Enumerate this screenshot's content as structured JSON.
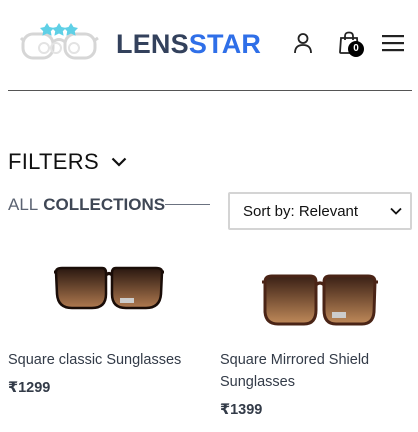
{
  "header": {
    "brand_part1": "LENS",
    "brand_part2": "STAR",
    "cart_count": "0",
    "brand_colors": {
      "dark": "#33415c",
      "accent": "#2f6fe8"
    },
    "icons": [
      "logo-glasses-icon",
      "user-icon",
      "shopping-bag-icon",
      "hamburger-menu-icon"
    ]
  },
  "filters": {
    "label": "FILTERS",
    "icon": "chevron-down-icon"
  },
  "collections": {
    "all_label": "ALL",
    "name_label": "COLLECTIONS"
  },
  "sort": {
    "selected": "Sort by: Relevant",
    "options": [
      "Sort by: Relevant"
    ]
  },
  "products": [
    {
      "name": "Square classic Sunglasses",
      "price": "₹1299"
    },
    {
      "name": "Square Mirrored Shield Sunglasses",
      "price": "₹1399"
    }
  ]
}
